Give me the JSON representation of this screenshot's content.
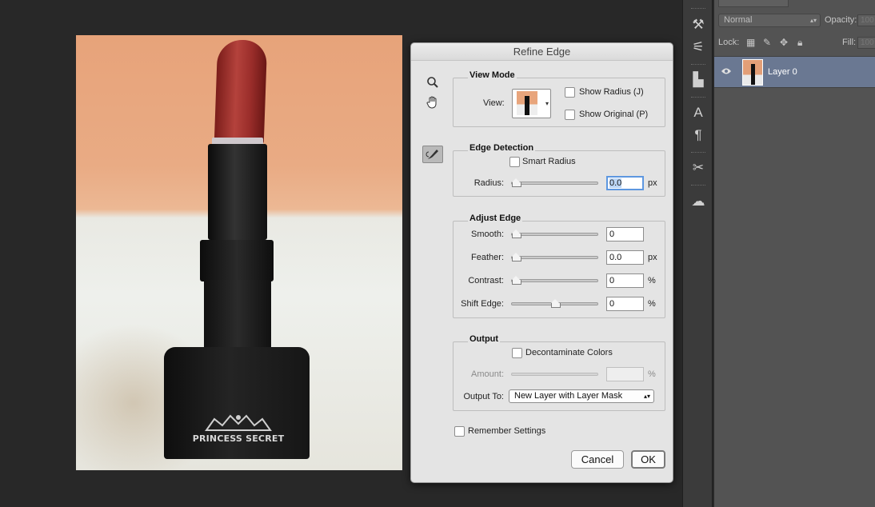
{
  "canvas": {
    "brand_text": "PRINCESS SECRET"
  },
  "dialog": {
    "title": "Refine Edge",
    "view_mode": {
      "title": "View Mode",
      "view_label": "View:",
      "show_radius": {
        "label": "Show Radius (J)",
        "checked": false
      },
      "show_original": {
        "label": "Show Original (P)",
        "checked": false
      }
    },
    "edge_detection": {
      "title": "Edge Detection",
      "smart_radius": {
        "label": "Smart Radius",
        "checked": false
      },
      "radius": {
        "label": "Radius:",
        "value": "0.0",
        "unit": "px",
        "slider": 0
      }
    },
    "adjust_edge": {
      "title": "Adjust Edge",
      "smooth": {
        "label": "Smooth:",
        "value": "0",
        "unit": "",
        "slider": 0
      },
      "feather": {
        "label": "Feather:",
        "value": "0.0",
        "unit": "px",
        "slider": 0
      },
      "contrast": {
        "label": "Contrast:",
        "value": "0",
        "unit": "%",
        "slider": 0
      },
      "shift_edge": {
        "label": "Shift Edge:",
        "value": "0",
        "unit": "%",
        "slider": 0.5
      }
    },
    "output": {
      "title": "Output",
      "decontaminate": {
        "label": "Decontaminate Colors",
        "checked": false
      },
      "amount": {
        "label": "Amount:",
        "value": "",
        "unit": "%",
        "disabled": true
      },
      "output_to": {
        "label": "Output To:",
        "value": "New Layer with Layer Mask"
      }
    },
    "remember": {
      "label": "Remember Settings",
      "checked": false
    },
    "cancel_label": "Cancel",
    "ok_label": "OK"
  },
  "layers_panel": {
    "blend_mode": "Normal",
    "opacity_label": "Opacity:",
    "opacity_value": "100",
    "lock_label": "Lock:",
    "fill_label": "Fill:",
    "fill_value": "100",
    "layers": [
      {
        "name": "Layer 0",
        "visible": true,
        "selected": true
      }
    ]
  }
}
